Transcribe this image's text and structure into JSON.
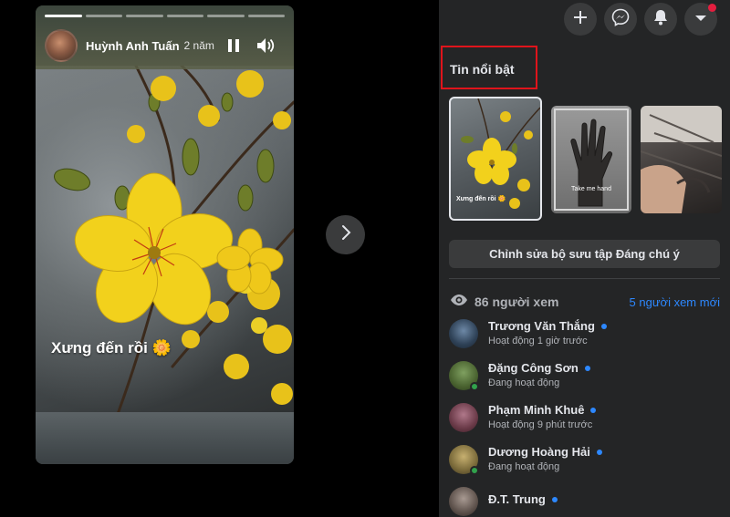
{
  "story": {
    "author": "Huỳnh Anh Tuấn",
    "time": "2 năm",
    "caption": "Xưng đến rồi 🌼",
    "progress": [
      1,
      0,
      0,
      0,
      0,
      0
    ],
    "controls": {
      "pause_icon": "pause-icon",
      "volume_icon": "volume-icon"
    }
  },
  "navigation": {
    "next_icon": "chevron-right-icon"
  },
  "top_bar": {
    "icons": [
      "plus-icon",
      "messenger-icon",
      "bell-icon",
      "caret-down-icon"
    ],
    "notification_color": "#e41e3f"
  },
  "highlights": {
    "title": "Tin nổi bật",
    "thumbnails": [
      {
        "caption": "Xưng đến rồi 🌼"
      },
      {
        "caption": "Take me hand"
      },
      {
        "caption": ""
      }
    ],
    "edit_label": "Chỉnh sửa bộ sưu tập Đáng chú ý"
  },
  "viewers": {
    "count_label": "86 người xem",
    "new_label": "5 người xem mới",
    "list": [
      {
        "name": "Trương Văn Thắng",
        "status": "Hoạt động 1 giờ trước",
        "online": false
      },
      {
        "name": "Đặng Công Sơn",
        "status": "Đang hoạt động",
        "online": true
      },
      {
        "name": "Phạm Minh Khuê",
        "status": "Hoạt động 9 phút trước",
        "online": false
      },
      {
        "name": "Dương Hoàng Hải",
        "status": "Đang hoạt động",
        "online": true
      },
      {
        "name": "Đ.T. Trung",
        "status": "",
        "online": false
      }
    ]
  },
  "colors": {
    "accent": "#2d88ff",
    "online": "#31a24c",
    "highlight_border": "#e0141b",
    "panel_bg": "#242526"
  }
}
